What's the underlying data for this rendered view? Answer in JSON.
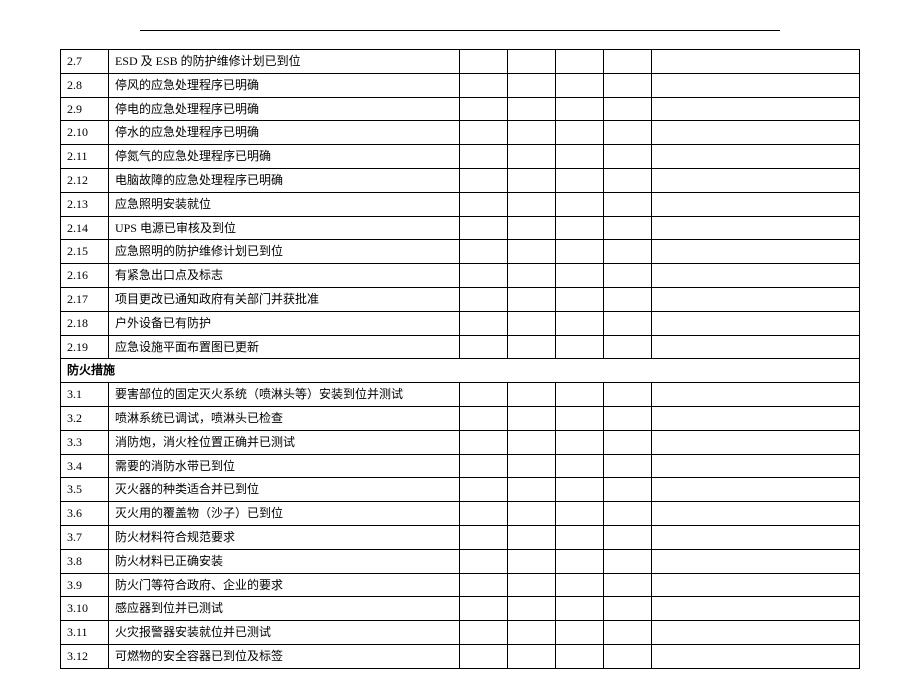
{
  "section1": {
    "rows": [
      {
        "num": "2.7",
        "desc": "ESD 及 ESB 的防护维修计划已到位"
      },
      {
        "num": "2.8",
        "desc": "停风的应急处理程序已明确"
      },
      {
        "num": "2.9",
        "desc": "停电的应急处理程序已明确"
      },
      {
        "num": "2.10",
        "desc": "停水的应急处理程序已明确"
      },
      {
        "num": "2.11",
        "desc": "停氮气的应急处理程序已明确"
      },
      {
        "num": "2.12",
        "desc": "电脑故障的应急处理程序已明确"
      },
      {
        "num": "2.13",
        "desc": "应急照明安装就位"
      },
      {
        "num": "2.14",
        "desc": "UPS 电源已审核及到位"
      },
      {
        "num": "2.15",
        "desc": "应急照明的防护维修计划已到位"
      },
      {
        "num": "2.16",
        "desc": "有紧急出口点及标志"
      },
      {
        "num": "2.17",
        "desc": "项目更改已通知政府有关部门并获批准"
      },
      {
        "num": "2.18",
        "desc": "户外设备已有防护"
      },
      {
        "num": "2.19",
        "desc": "应急设施平面布置图已更新"
      }
    ]
  },
  "section2": {
    "title": "防火措施",
    "rows": [
      {
        "num": "3.1",
        "desc": "要害部位的固定灭火系统（喷淋头等）安装到位并测试"
      },
      {
        "num": "3.2",
        "desc": "喷淋系统已调试，喷淋头已检查"
      },
      {
        "num": "3.3",
        "desc": "消防炮，消火栓位置正确并已测试"
      },
      {
        "num": "3.4",
        "desc": "需要的消防水带已到位"
      },
      {
        "num": "3.5",
        "desc": "灭火器的种类适合并已到位"
      },
      {
        "num": "3.6",
        "desc": "灭火用的覆盖物（沙子）已到位"
      },
      {
        "num": "3.7",
        "desc": "防火材料符合规范要求"
      },
      {
        "num": "3.8",
        "desc": "防火材料已正确安装"
      },
      {
        "num": "3.9",
        "desc": "防火门等符合政府、企业的要求"
      },
      {
        "num": "3.10",
        "desc": "感应器到位并已测试"
      },
      {
        "num": "3.11",
        "desc": "火灾报警器安装就位并已测试"
      },
      {
        "num": "3.12",
        "desc": "可燃物的安全容器已到位及标签"
      }
    ]
  }
}
